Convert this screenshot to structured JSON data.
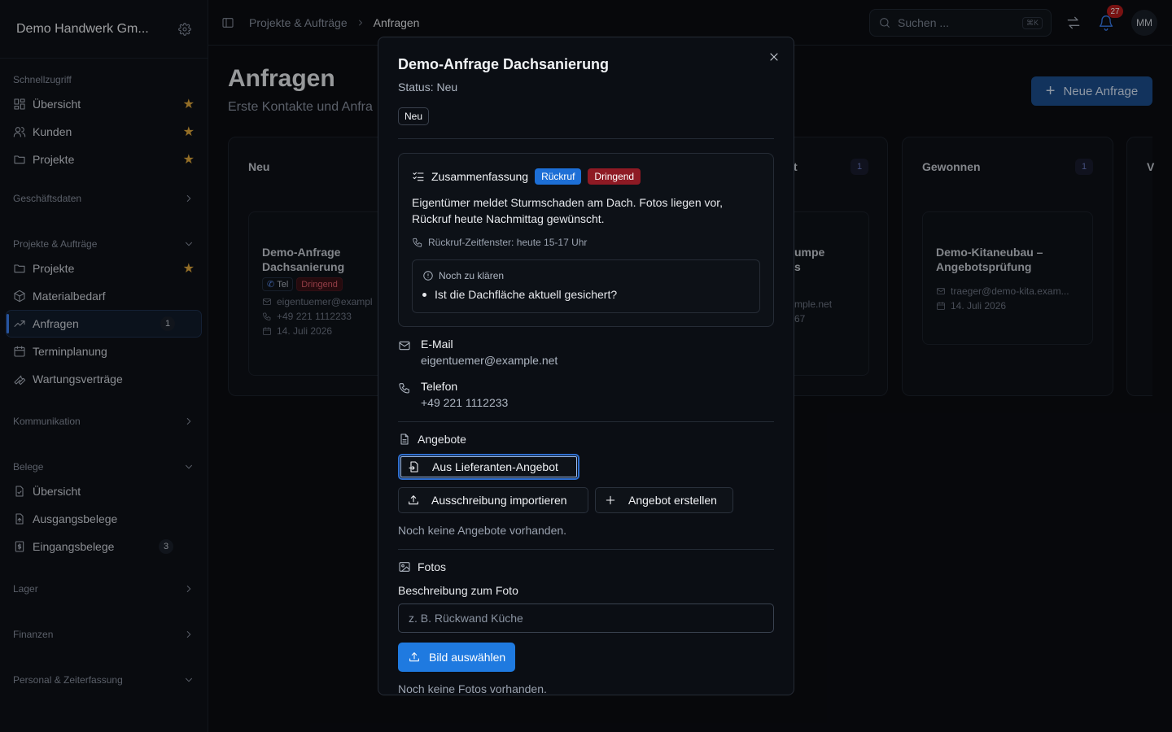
{
  "company": "Demo Handwerk Gm...",
  "sidebar": {
    "quick_access": {
      "title": "Schnellzugriff",
      "items": [
        {
          "label": "Übersicht"
        },
        {
          "label": "Kunden"
        },
        {
          "label": "Projekte"
        }
      ]
    },
    "business_data": "Geschäftsdaten",
    "projects": {
      "title": "Projekte & Aufträge",
      "items": [
        {
          "label": "Projekte"
        },
        {
          "label": "Materialbedarf"
        },
        {
          "label": "Anfragen",
          "count": "1"
        },
        {
          "label": "Terminplanung"
        },
        {
          "label": "Wartungsverträge"
        }
      ]
    },
    "communication": "Kommunikation",
    "receipts": {
      "title": "Belege",
      "items": [
        {
          "label": "Übersicht"
        },
        {
          "label": "Ausgangsbelege"
        },
        {
          "label": "Eingangsbelege",
          "count": "3"
        }
      ]
    },
    "stock": "Lager",
    "finance": "Finanzen",
    "personnel": "Personal & Zeiterfassung"
  },
  "topbar": {
    "breadcrumb": [
      "Projekte & Aufträge",
      "Anfragen"
    ],
    "search_placeholder": "Suchen ...",
    "search_shortcut": "⌘K",
    "notifications": "27",
    "avatar": "MM"
  },
  "page": {
    "title": "Anfragen",
    "subtitle": "Erste Kontakte und Anfra",
    "new_button": "Neue Anfrage"
  },
  "board": {
    "columns": [
      {
        "title": "Neu"
      },
      {
        "title": "t",
        "count": "1"
      },
      {
        "title": "Gewonnen",
        "count": "1"
      },
      {
        "title": "V"
      }
    ],
    "cards": {
      "neu": {
        "title": "Demo-Anfrage Dachsanierung",
        "tag_phone": "Tel",
        "tag_urgent": "Dringend",
        "email": "eigentuemer@exampl",
        "phone": "+49 221 1112233",
        "date": "14. Juli 2026"
      },
      "partial": {
        "title_fragment_1": "umpe",
        "title_fragment_2": "s",
        "email_fragment": "mple.net",
        "phone_fragment": "67"
      },
      "gewonnen": {
        "title": "Demo-Kitaneubau – Angebotsprüfung",
        "email": "traeger@demo-kita.exam...",
        "date": "14. Juli 2026"
      }
    }
  },
  "modal": {
    "title": "Demo-Anfrage Dachsanierung",
    "status": "Status: Neu",
    "status_tag": "Neu",
    "summary": {
      "title": "Zusammenfassung",
      "tag_callback": "Rückruf",
      "tag_urgent": "Dringend",
      "text": "Eigentümer meldet Sturmschaden am Dach. Fotos liegen vor, Rückruf heute Nachmittag gewünscht.",
      "callback_window": "Rückruf-Zeitfenster: heute 15-17 Uhr",
      "open_title": "Noch zu klären",
      "open_items": [
        "Ist die Dachfläche aktuell gesichert?"
      ]
    },
    "email_label": "E-Mail",
    "email": "eigentuemer@example.net",
    "phone_label": "Telefon",
    "phone": "+49 221 1112233",
    "offers": {
      "title": "Angebote",
      "from_supplier": "Aus Lieferanten-Angebot",
      "import_tender": "Ausschreibung importieren",
      "create_offer": "Angebot erstellen",
      "empty": "Noch keine Angebote vorhanden."
    },
    "photos": {
      "title": "Fotos",
      "description_label": "Beschreibung zum Foto",
      "description_placeholder": "z. B. Rückwand Küche",
      "choose_button": "Bild auswählen",
      "empty": "Noch keine Fotos vorhanden."
    }
  }
}
